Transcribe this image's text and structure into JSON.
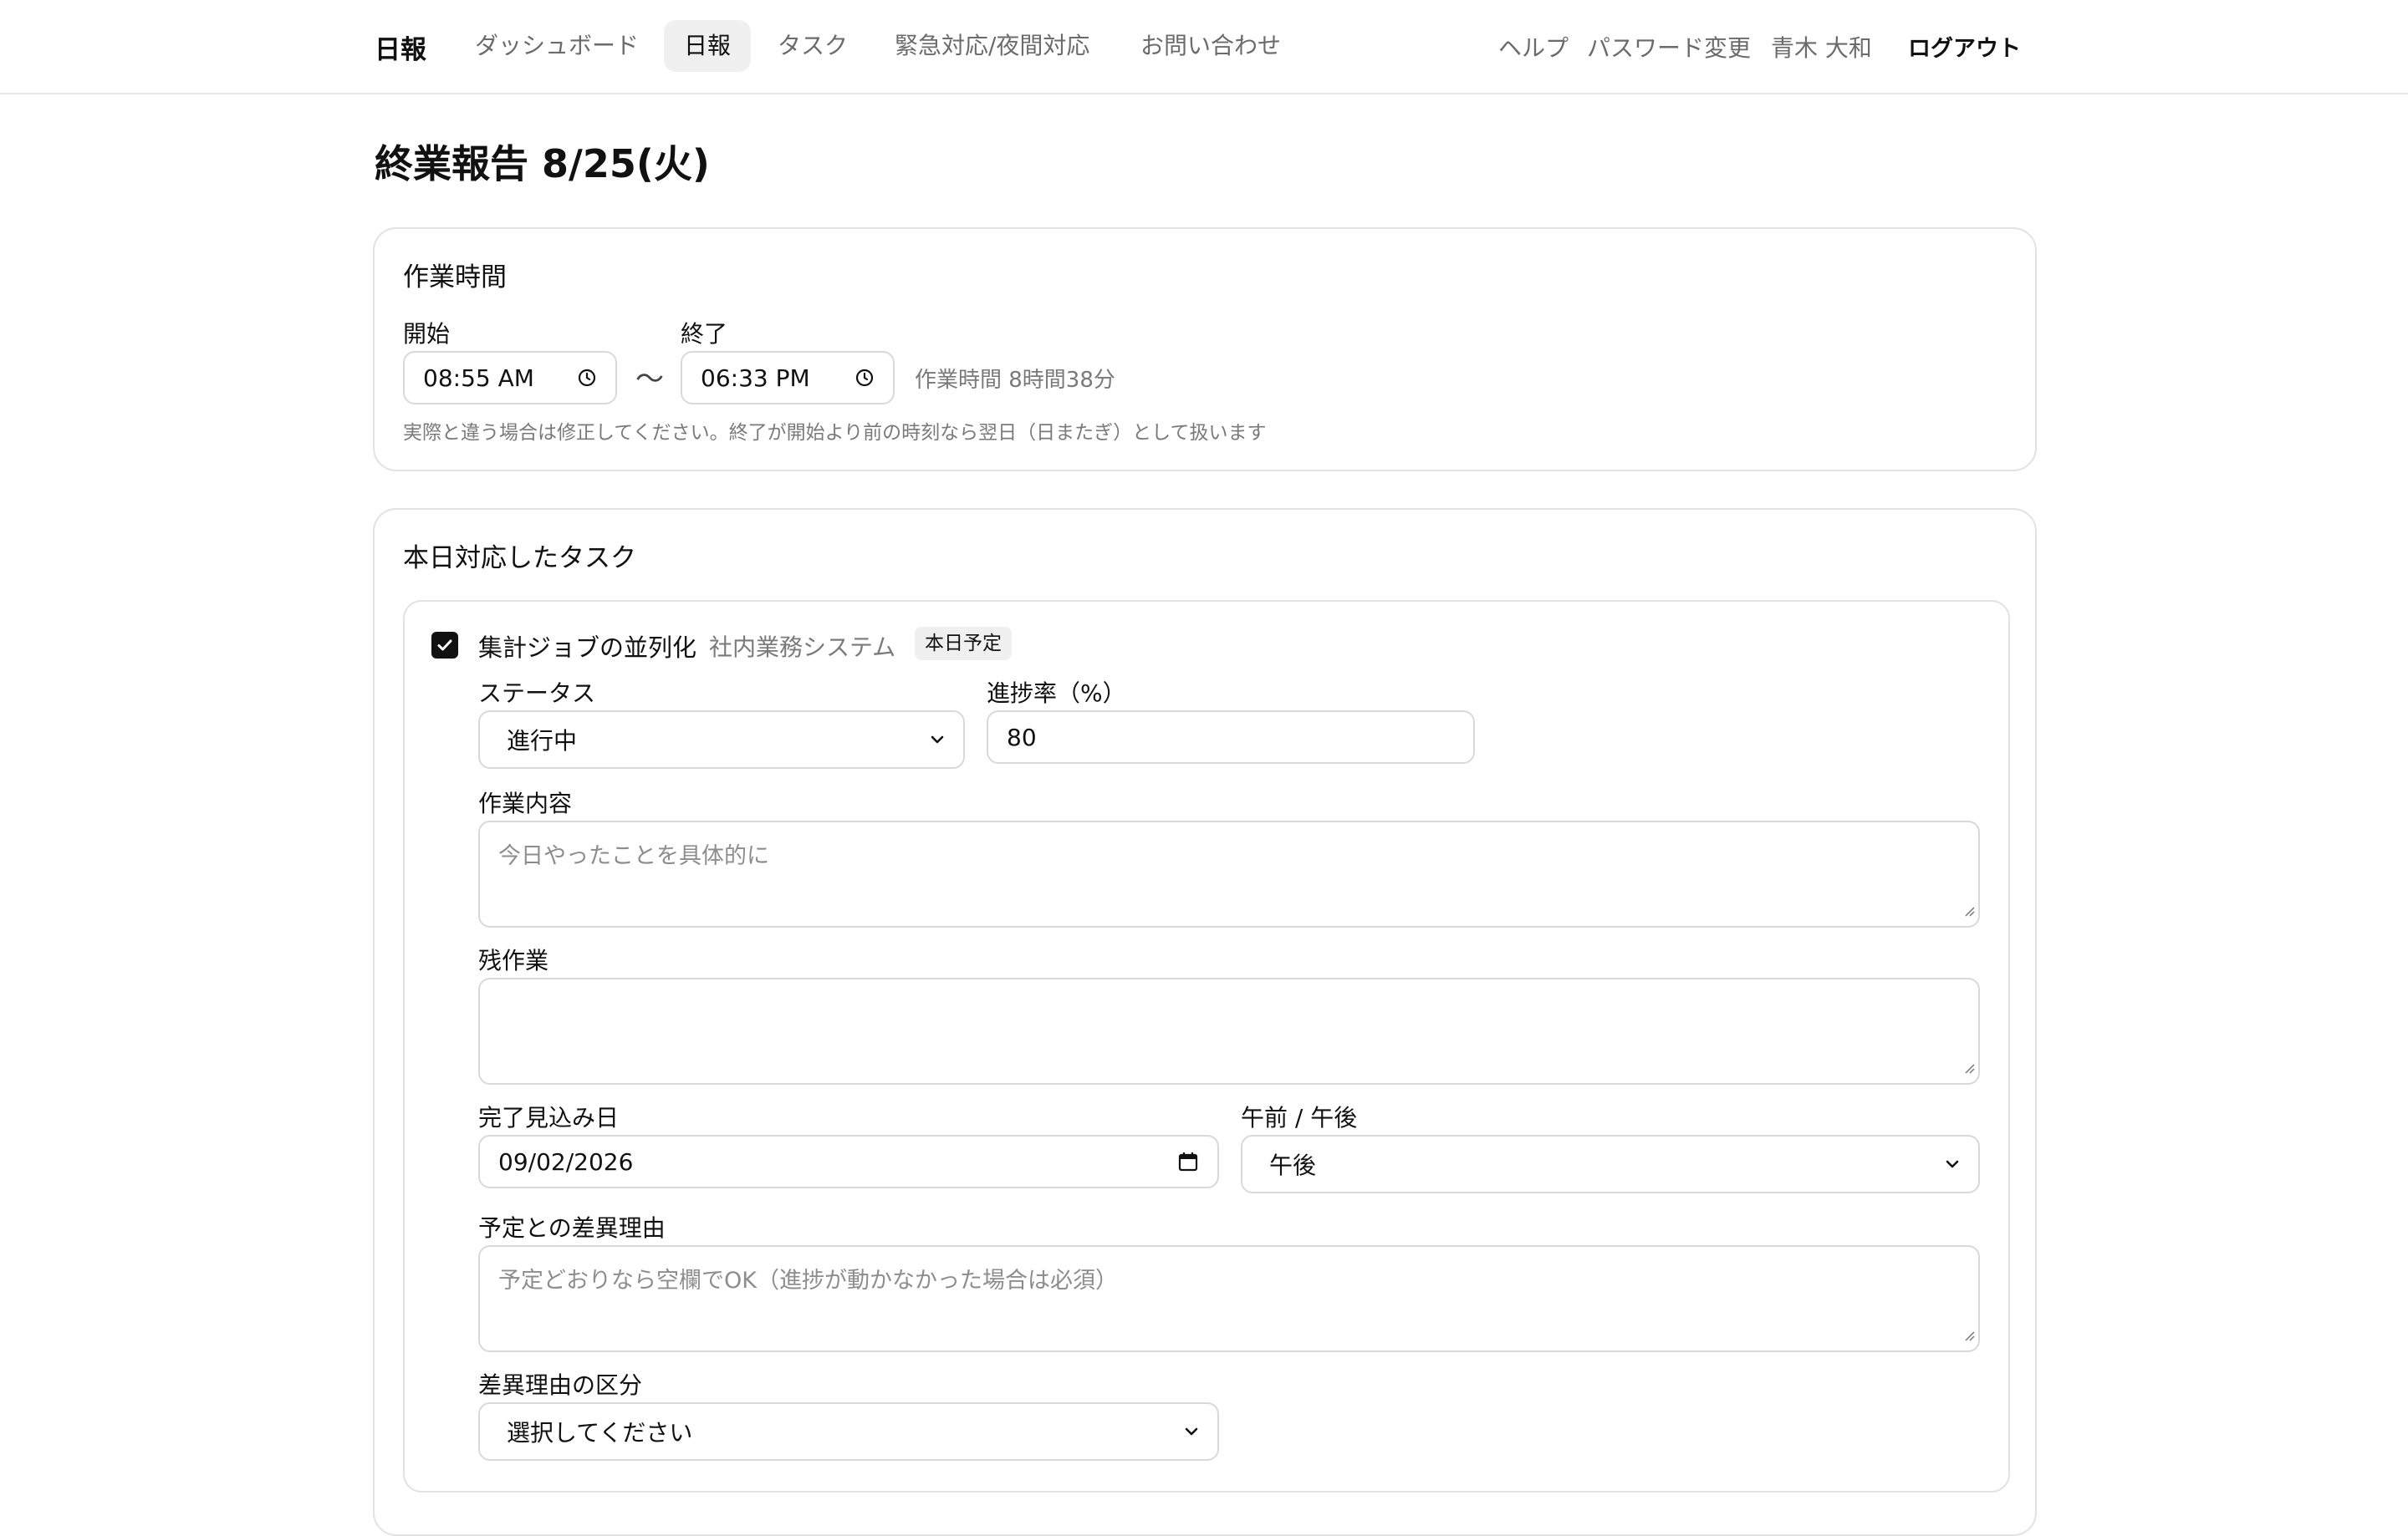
{
  "nav": {
    "brand": "日報",
    "items": [
      {
        "label": "ダッシュボード"
      },
      {
        "label": "日報"
      },
      {
        "label": "タスク"
      },
      {
        "label": "緊急対応/夜間対応"
      },
      {
        "label": "お問い合わせ"
      }
    ],
    "active_index": 1,
    "help": "ヘルプ",
    "password": "パスワード変更",
    "user": "青木 大和",
    "logout": "ログアウト"
  },
  "page": {
    "title": "終業報告 8/25(火)"
  },
  "work_time": {
    "title": "作業時間",
    "start_label": "開始",
    "start_value": "08:55 AM",
    "separator": "〜",
    "end_label": "終了",
    "end_value": "06:33 PM",
    "duration": "作業時間 8時間38分",
    "hint": "実際と違う場合は修正してください。終了が開始より前の時刻なら翌日（日またぎ）として扱います"
  },
  "tasks": {
    "title": "本日対応したタスク",
    "task": {
      "checked": true,
      "name": "集計ジョブの並列化",
      "project": "社内業務システム",
      "badge": "本日予定",
      "status_label": "ステータス",
      "status_value": "進行中",
      "progress_label": "進捗率（%）",
      "progress_value": "80",
      "content_label": "作業内容",
      "content_placeholder": "今日やったことを具体的に",
      "remaining_label": "残作業",
      "remaining_value": "",
      "due_label": "完了見込み日",
      "due_value": "09/02/2026",
      "ampm_label": "午前 / 午後",
      "ampm_value": "午後",
      "diff_reason_label": "予定との差異理由",
      "diff_reason_placeholder": "予定どおりなら空欄でOK（進捗が動かなかった場合は必須）",
      "diff_category_label": "差異理由の区分",
      "diff_category_value": "選択してください"
    }
  }
}
